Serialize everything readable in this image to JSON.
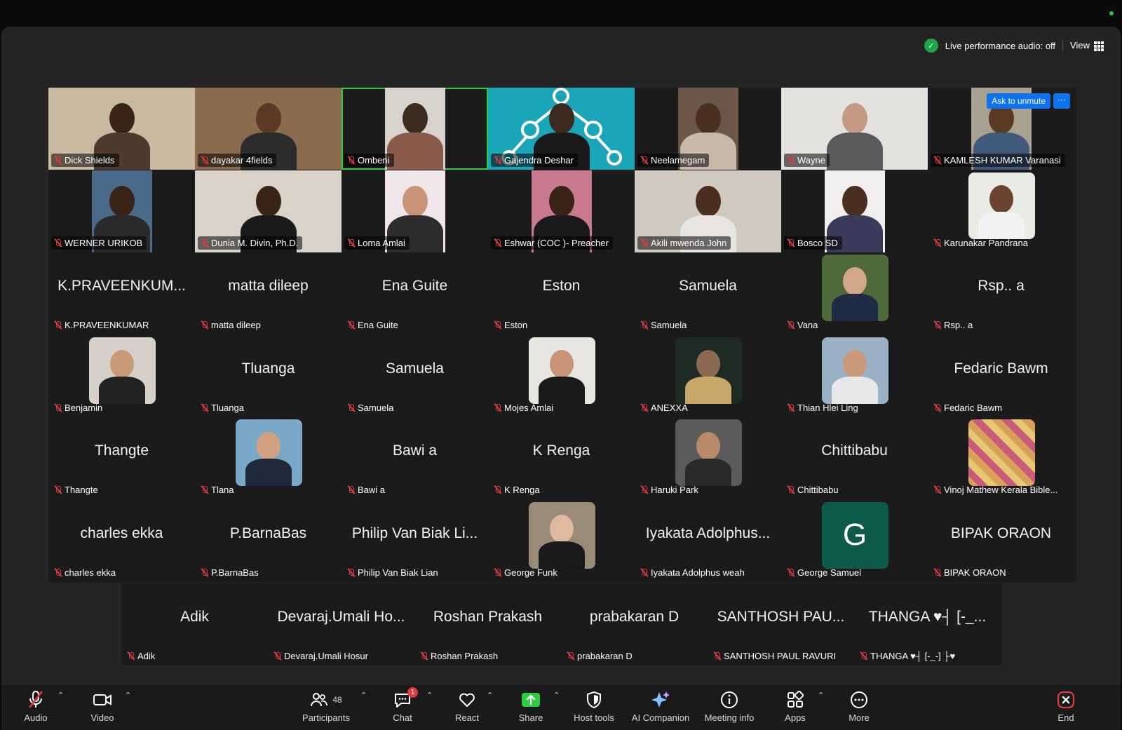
{
  "status": {
    "live_audio": "Live performance audio: off",
    "view_label": "View"
  },
  "ask_to_unmute": "Ask to unmute",
  "tiles": [
    {
      "label": "Dick Shields",
      "big": "",
      "video": {
        "bg": "#c9b9a0",
        "skin": "#3a2418",
        "shirt": "#4e3a2e"
      }
    },
    {
      "label": "dayakar 4fields",
      "big": "",
      "video": {
        "bg": "#8a6b4d",
        "skin": "#5a3a24",
        "shirt": "#2c2c2c"
      }
    },
    {
      "label": "Ombeni",
      "big": "",
      "active": true,
      "video": {
        "bg": "#d8d4cc",
        "skin": "#3b2a20",
        "shirt": "#8a5b4a",
        "narrow": true
      }
    },
    {
      "label": "Gajendra Deshar",
      "big": "",
      "video": {
        "bg": "#1aa5b8",
        "skin": "#3c2a1e",
        "shirt": "#1a1a1a",
        "network": true
      }
    },
    {
      "label": "Neelamegam",
      "big": "",
      "video": {
        "bg": "#6b5648",
        "skin": "#4a3020",
        "shirt": "#c8b8a8",
        "narrow": true
      }
    },
    {
      "label": "Wayne",
      "big": "",
      "video": {
        "bg": "#e4e2df",
        "skin": "#c49a84",
        "shirt": "#5a5a5a"
      }
    },
    {
      "label": "KAMLESH KUMAR Varanasi",
      "big": "",
      "video": {
        "bg": "#a8a090",
        "skin": "#5b3a24",
        "shirt": "#3f5a7a",
        "narrow": true
      },
      "ask": true
    },
    {
      "label": "WERNER URIKOB",
      "big": "",
      "video": {
        "bg": "#4a6a8a",
        "skin": "#3a2418",
        "shirt": "#2a2a2a",
        "narrow": true
      }
    },
    {
      "label": "Dunia M. Divin, Ph.D.",
      "big": "",
      "video": {
        "bg": "#d8d2c8",
        "skin": "#3a2418",
        "shirt": "#1a1a1a"
      }
    },
    {
      "label": "Loma Amlai",
      "big": "",
      "video": {
        "bg": "#efe6ea",
        "skin": "#c89478",
        "shirt": "#2c2c2c",
        "narrow": true
      }
    },
    {
      "label": "Eshwar (COC )- Preacher",
      "big": "",
      "video": {
        "bg": "#c97a8e",
        "skin": "#3a2418",
        "shirt": "#1a1a1a",
        "narrow": true
      }
    },
    {
      "label": "Akili mwenda John",
      "big": "",
      "video": {
        "bg": "#cfc9c0",
        "skin": "#4a2e20",
        "shirt": "#e8e4e0"
      }
    },
    {
      "label": "Bosco SD",
      "big": "",
      "video": {
        "bg": "#f0efee",
        "skin": "#4a2e20",
        "shirt": "#3a3a5a",
        "narrow": true
      }
    },
    {
      "label": "Karunakar Pandrana",
      "big": "",
      "video": {
        "bg": "#e8ece4",
        "skin": "#6a4430",
        "shirt": "#f2f2f2",
        "avatar": true
      }
    },
    {
      "label": "K.PRAVEENKUMAR",
      "big": "K.PRAVEENKUM..."
    },
    {
      "label": "matta dileep",
      "big": "matta dileep"
    },
    {
      "label": "Ena Guite",
      "big": "Ena Guite"
    },
    {
      "label": "Eston",
      "big": "Eston"
    },
    {
      "label": "Samuela",
      "big": "Samuela"
    },
    {
      "label": "Vana",
      "big": "",
      "video": {
        "bg": "#4f6a3a",
        "skin": "#d2a888",
        "shirt": "#1f2a44",
        "avatar": true
      }
    },
    {
      "label": "Rsp.. a",
      "big": "Rsp.. a"
    },
    {
      "label": "Benjamin",
      "big": "",
      "video": {
        "bg": "#d6d0c8",
        "skin": "#c89a78",
        "shirt": "#222",
        "avatar": true
      }
    },
    {
      "label": "Tluanga",
      "big": "Tluanga"
    },
    {
      "label": "Samuela",
      "big": "Samuela"
    },
    {
      "label": "Mojes Amlai",
      "big": "",
      "video": {
        "bg": "#e8e6e0",
        "skin": "#c89478",
        "shirt": "#1a1a1a",
        "avatar": true
      }
    },
    {
      "label": "ANEXXA",
      "big": "",
      "video": {
        "bg": "#1e2a24",
        "skin": "#8a6a50",
        "shirt": "#c8a868",
        "avatar": true
      }
    },
    {
      "label": "Thian Hlei Ling",
      "big": "",
      "video": {
        "bg": "#9ab0c4",
        "skin": "#c89a7a",
        "shirt": "#e8e8e8",
        "avatar": true
      }
    },
    {
      "label": "Fedaric Bawm",
      "big": "Fedaric Bawm"
    },
    {
      "label": "Thangte",
      "big": "Thangte"
    },
    {
      "label": "Tlana",
      "big": "",
      "video": {
        "bg": "#7aa8c8",
        "skin": "#d0a080",
        "shirt": "#1e2a3a",
        "avatar": true
      }
    },
    {
      "label": "Bawi a",
      "big": "Bawi a"
    },
    {
      "label": "K Renga",
      "big": "K Renga"
    },
    {
      "label": "Haruki Park",
      "big": "",
      "video": {
        "bg": "#5a5a5a",
        "skin": "#b88a6a",
        "shirt": "#2a2a2a",
        "avatar": true
      }
    },
    {
      "label": "Chittibabu",
      "big": "Chittibabu"
    },
    {
      "label": "Vinoj Mathew Kerala Bible...",
      "big": "",
      "video": {
        "bg": "#d8a058",
        "skin": "#c85a7a",
        "shirt": "#e8c870",
        "avatar": true,
        "pattern": true
      }
    },
    {
      "label": "charles ekka",
      "big": "charles ekka"
    },
    {
      "label": "P.BarnaBas",
      "big": "P.BarnaBas"
    },
    {
      "label": "Philip Van Biak Lian",
      "big": "Philip Van Biak Li..."
    },
    {
      "label": "George Funk",
      "big": "",
      "video": {
        "bg": "#9a8a78",
        "skin": "#e0b8a0",
        "shirt": "#1a1a1a",
        "avatar": true
      }
    },
    {
      "label": "Iyakata Adolphus weah",
      "big": "Iyakata Adolphus..."
    },
    {
      "label": "George Samuel",
      "big": "",
      "letter": "G"
    },
    {
      "label": "BIPAK ORAON",
      "big": "BIPAK ORAON"
    }
  ],
  "bottom_tiles": [
    {
      "label": "Adik",
      "big": "Adik"
    },
    {
      "label": "Devaraj.Umali Hosur",
      "big": "Devaraj.Umali Ho..."
    },
    {
      "label": "Roshan Prakash",
      "big": "Roshan Prakash"
    },
    {
      "label": "prabakaran D",
      "big": "prabakaran D"
    },
    {
      "label": "SANTHOSH PAUL RAVURI",
      "big": "SANTHOSH PAU..."
    },
    {
      "label": "THANGA ♥┤ [-_-] ├♥",
      "big": "THANGA ♥┤ [-_..."
    }
  ],
  "toolbar": {
    "audio": "Audio",
    "video": "Video",
    "participants": "Participants",
    "participants_count": "48",
    "chat": "Chat",
    "chat_badge": "1",
    "react": "React",
    "share": "Share",
    "host_tools": "Host tools",
    "ai_companion": "AI Companion",
    "meeting_info": "Meeting info",
    "apps": "Apps",
    "more": "More",
    "end": "End"
  },
  "colors": {
    "accent_green": "#2ecc40",
    "accent_blue": "#0e72ed",
    "muted_red": "#e0393e",
    "letter_avatar_bg": "#0b5a4a"
  }
}
